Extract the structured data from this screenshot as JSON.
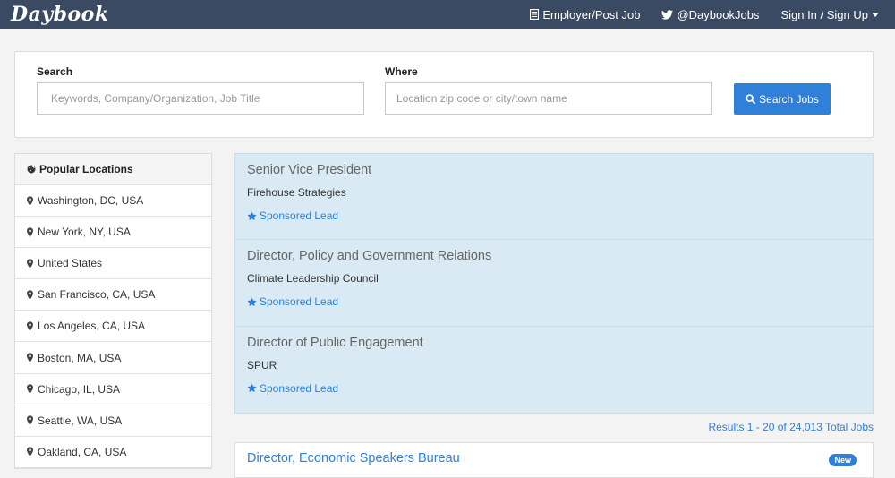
{
  "navbar": {
    "logo": "Daybook",
    "employer_label": "Employer/Post Job",
    "twitter_label": "@DaybookJobs",
    "signin_label": "Sign In / Sign Up"
  },
  "search": {
    "search_label": "Search",
    "search_placeholder": "Keywords, Company/Organization, Job Title",
    "where_label": "Where",
    "where_placeholder": "Location zip code or city/town name",
    "button_label": "Search Jobs"
  },
  "locations": {
    "header": "Popular Locations",
    "items": [
      {
        "label": "Washington, DC, USA"
      },
      {
        "label": "New York, NY, USA"
      },
      {
        "label": "United States"
      },
      {
        "label": "San Francisco, CA, USA"
      },
      {
        "label": "Los Angeles, CA, USA"
      },
      {
        "label": "Boston, MA, USA"
      },
      {
        "label": "Chicago, IL, USA"
      },
      {
        "label": "Seattle, WA, USA"
      },
      {
        "label": "Oakland, CA, USA"
      }
    ]
  },
  "sponsored_jobs": [
    {
      "title": "Senior Vice President",
      "company": "Firehouse Strategies",
      "tag": "Sponsored Lead"
    },
    {
      "title": "Director, Policy and Government Relations",
      "company": "Climate Leadership Council",
      "tag": "Sponsored Lead"
    },
    {
      "title": "Director of Public Engagement",
      "company": "SPUR",
      "tag": "Sponsored Lead"
    }
  ],
  "results_text": "Results 1 - 20 of 24,013 Total Jobs",
  "listings": [
    {
      "title": "Director, Economic Speakers Bureau",
      "badge": "New"
    }
  ],
  "colors": {
    "navbar": "#3b4a63",
    "accent": "#2f80d9",
    "sponsored_bg": "#d9eaf4"
  }
}
